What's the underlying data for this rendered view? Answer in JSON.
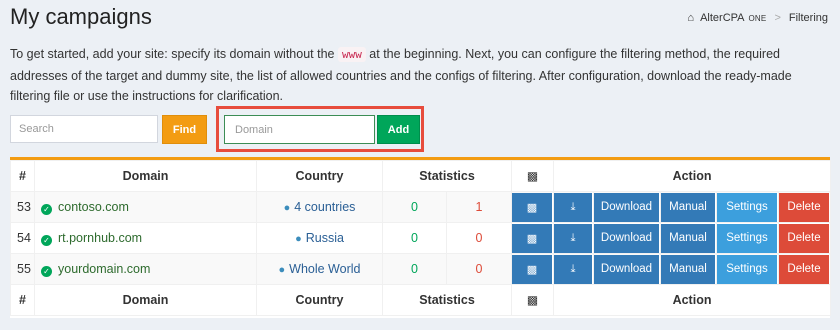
{
  "header": {
    "title": "My campaigns",
    "breadcrumb": {
      "brand": "AlterCPA",
      "brand_suffix": "ONE",
      "current": "Filtering"
    }
  },
  "intro": {
    "before_code": "To get started, add your site: specify its domain without the ",
    "code": "www",
    "after_code": " at the beginning. Next, you can configure the filtering method, the required addresses of the target and dummy site, the list of allowed countries and the configs of filtering. After configuration, download the ready-made filtering file or use the instructions for clarification."
  },
  "search": {
    "placeholder": "Search",
    "button_label": "Find"
  },
  "add_domain": {
    "placeholder": "Domain",
    "button_label": "Add"
  },
  "table": {
    "headers": {
      "num": "#",
      "domain": "Domain",
      "country": "Country",
      "statistics": "Statistics",
      "chart_icon": "bar-chart-icon",
      "action": "Action"
    },
    "rows": [
      {
        "id": "53",
        "domain": "contoso.com",
        "country": "4 countries",
        "stat_a": "0",
        "stat_b": "1"
      },
      {
        "id": "54",
        "domain": "rt.pornhub.com",
        "country": "Russia",
        "stat_a": "0",
        "stat_b": "0"
      },
      {
        "id": "55",
        "domain": "yourdomain.com",
        "country": "Whole World",
        "stat_a": "0",
        "stat_b": "0"
      }
    ],
    "action_labels": {
      "download": "Download",
      "manual": "Manual",
      "settings": "Settings",
      "delete": "Delete"
    }
  },
  "colors": {
    "accent_orange": "#f39c12",
    "success_green": "#00a65a",
    "primary_blue": "#337ab7",
    "info_blue": "#3c9fdd",
    "danger_red": "#dd4b39",
    "highlight_red": "#e74c3c"
  }
}
